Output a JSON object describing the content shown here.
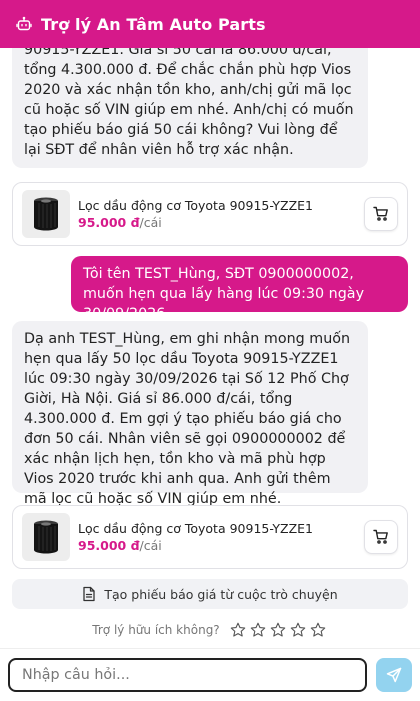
{
  "header": {
    "title": "Trợ lý An Tâm Auto Parts"
  },
  "messages": [
    {
      "role": "assistant",
      "text": "90915-YZZE1. Giá sỉ 50 cái là 86.000 đ/cái, tổng 4.300.000 đ. Để chắc chắn phù hợp Vios 2020 và xác nhận tồn kho, anh/chị gửi mã lọc cũ hoặc số VIN giúp em nhé. Anh/chị có muốn tạo phiếu báo giá 50 cái không? Vui lòng để lại SĐT để nhân viên hỗ trợ xác nhận."
    },
    {
      "role": "user",
      "text": "Tôi tên TEST_Hùng, SĐT 0900000002, muốn hẹn qua lấy hàng lúc 09:30 ngày 30/09/2026"
    },
    {
      "role": "assistant",
      "text": "Dạ anh TEST_Hùng, em ghi nhận mong muốn hẹn qua lấy 50 lọc dầu Toyota 90915-YZZE1 lúc 09:30 ngày 30/09/2026 tại Số 12 Phố Chợ Giời, Hà Nội. Giá sỉ 86.000 đ/cái, tổng 4.300.000 đ. Em gợi ý tạo phiếu báo giá cho đơn 50 cái. Nhân viên sẽ gọi 0900000002 để xác nhận lịch hẹn, tồn kho và mã phù hợp Vios 2020 trước khi anh qua. Anh gửi thêm mã lọc cũ hoặc số VIN giúp em nhé."
    }
  ],
  "products": [
    {
      "name": "Lọc dầu động cơ Toyota 90915-YZZE1",
      "price": "95.000 đ",
      "unit": "/cái",
      "icon": "oil-filter-icon"
    },
    {
      "name": "Lọc dầu động cơ Toyota 90915-YZZE1",
      "price": "95.000 đ",
      "unit": "/cái",
      "icon": "oil-filter-icon"
    }
  ],
  "quote_button": {
    "label": "Tạo phiếu báo giá từ cuộc trò chuyện",
    "icon": "document-icon"
  },
  "feedback": {
    "question": "Trợ lý hữu ích không?",
    "max_stars": 5,
    "rating": 0
  },
  "composer": {
    "placeholder": "Nhập câu hỏi...",
    "value": "",
    "send_icon": "send-icon"
  },
  "colors": {
    "brand": "#d6198a",
    "send_button": "#93d3ef",
    "bubble_bot": "#f1f1f4"
  }
}
